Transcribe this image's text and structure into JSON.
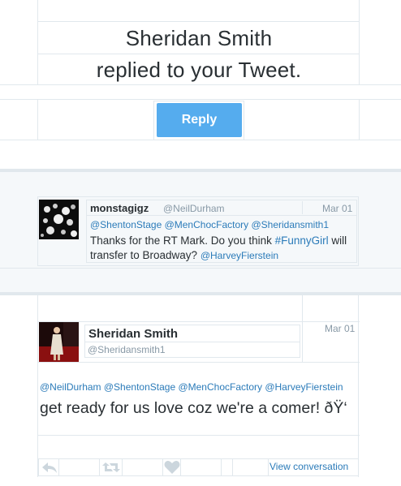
{
  "header": {
    "line1": "Sheridan Smith",
    "line2": "replied to your Tweet."
  },
  "reply_button": {
    "label": "Reply",
    "color": "#55acee"
  },
  "original_tweet": {
    "name": "monstagigz",
    "handle": "@NeilDurham",
    "date": "Mar 01",
    "mentions": "@ShentonStage @MenChocFactory @Sheridansmith1",
    "text_part1": "Thanks for the RT Mark. Do you think ",
    "hashtag": "#FunnyGirl",
    "text_part2": " will transfer to Broadway? ",
    "trailing_mention": "@HarveyFierstein"
  },
  "reply_tweet": {
    "name": "Sheridan Smith",
    "handle": "@Sheridansmith1",
    "date": "Mar 01",
    "mentions": "@NeilDurham @ShentonStage @MenChocFactory @HarveyFierstein",
    "text": "get ready for us love coz we're a comer! ðŸ‘"
  },
  "actions": {
    "reply_icon": "reply-icon",
    "retweet_icon": "retweet-icon",
    "favorite_icon": "heart-icon",
    "view_conversation": "View conversation"
  },
  "colors": {
    "link": "#2b7bb9",
    "muted": "#8899a6",
    "border": "#e1e8ed",
    "band": "#f5f8fa"
  }
}
